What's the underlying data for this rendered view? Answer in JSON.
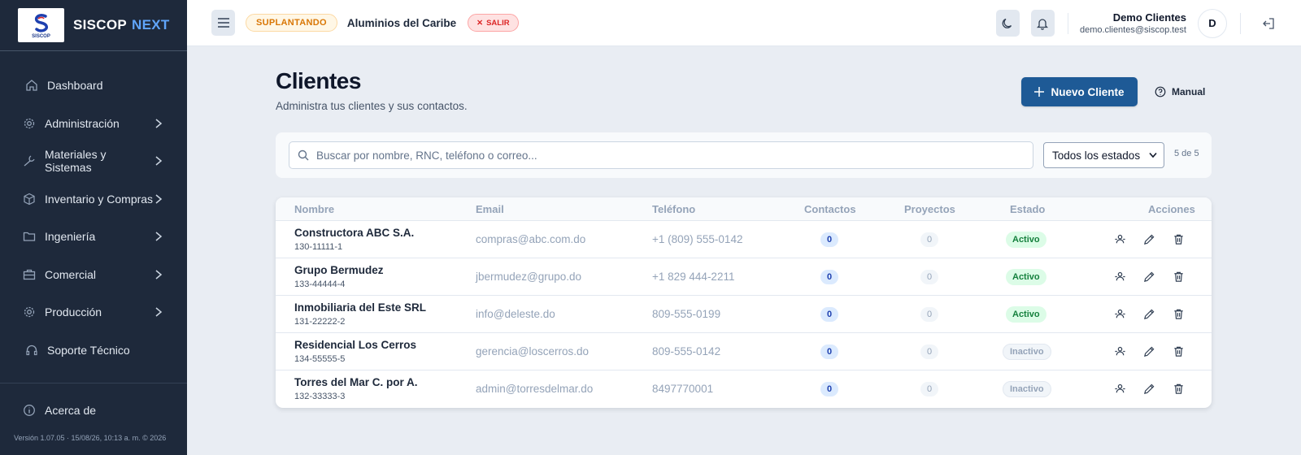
{
  "brand": {
    "name": "SISCOP",
    "suffix": "NEXT",
    "logo_text": "SISCOP"
  },
  "sidebar": {
    "items": [
      {
        "label": "Dashboard",
        "icon": "home-icon"
      },
      {
        "label": "Administración",
        "icon": "gear-icon"
      },
      {
        "label": "Materiales y Sistemas",
        "icon": "wrench-icon"
      },
      {
        "label": "Inventario y Compras",
        "icon": "box-icon"
      },
      {
        "label": "Ingeniería",
        "icon": "folder-icon"
      },
      {
        "label": "Comercial",
        "icon": "briefcase-icon"
      },
      {
        "label": "Producción",
        "icon": "gear-icon"
      },
      {
        "label": "Soporte Técnico",
        "icon": "headset-icon"
      }
    ],
    "about": "Acerca de",
    "version": "Versión 1.07.05 · 15/08/26, 10:13 a. m. © 2026"
  },
  "topbar": {
    "impersonating": "SUPLANTANDO",
    "company": "Aluminios del Caribe",
    "exit": "SALIR",
    "user_name": "Demo Clientes",
    "user_email": "demo.clientes@siscop.test",
    "avatar_initial": "D"
  },
  "page": {
    "title": "Clientes",
    "subtitle": "Administra tus clientes y sus contactos.",
    "new_button": "Nuevo Cliente",
    "manual_button": "Manual"
  },
  "filters": {
    "search_placeholder": "Buscar por nombre, RNC, teléfono o correo...",
    "status_selected": "Todos los estados",
    "count": "5 de 5"
  },
  "table": {
    "headers": [
      "Nombre",
      "Email",
      "Teléfono",
      "Contactos",
      "Proyectos",
      "Estado",
      "Acciones"
    ],
    "rows": [
      {
        "name": "Constructora ABC S.A.",
        "rnc": "130-11111-1",
        "email": "compras@abc.com.do",
        "phone": "+1 (809) 555-0142",
        "contacts": "0",
        "projects": "0",
        "status": "Activo"
      },
      {
        "name": "Grupo Bermudez",
        "rnc": "133-44444-4",
        "email": "jbermudez@grupo.do",
        "phone": "+1 829 444-2211",
        "contacts": "0",
        "projects": "0",
        "status": "Activo"
      },
      {
        "name": "Inmobiliaria del Este SRL",
        "rnc": "131-22222-2",
        "email": "info@deleste.do",
        "phone": "809-555-0199",
        "contacts": "0",
        "projects": "0",
        "status": "Activo"
      },
      {
        "name": "Residencial Los Cerros",
        "rnc": "134-55555-5",
        "email": "gerencia@loscerros.do",
        "phone": "809-555-0142",
        "contacts": "0",
        "projects": "0",
        "status": "Inactivo"
      },
      {
        "name": "Torres del Mar C. por A.",
        "rnc": "132-33333-3",
        "email": "admin@torresdelmar.do",
        "phone": "8497770001",
        "contacts": "0",
        "projects": "0",
        "status": "Inactivo"
      }
    ]
  },
  "colors": {
    "sidebar": "#1e293b",
    "primary": "#1e5a96",
    "accent": "#60a5fa",
    "active": "#15803d",
    "warning": "#d97706",
    "danger": "#dc2626"
  }
}
